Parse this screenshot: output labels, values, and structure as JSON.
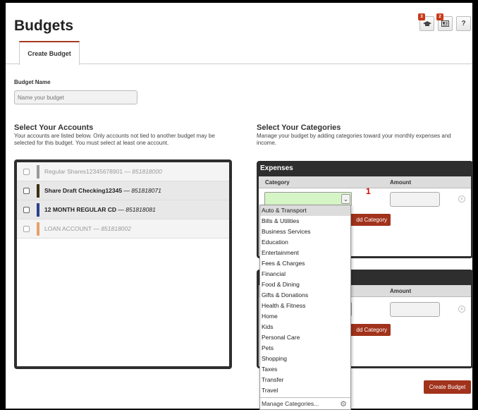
{
  "header": {
    "title": "Budgets",
    "badges": {
      "learn": "3",
      "news": "2"
    },
    "help_label": "?"
  },
  "tabs": [
    {
      "label": "Create Budget",
      "active": true
    }
  ],
  "budget_name": {
    "label": "Budget Name",
    "placeholder": "Name your budget",
    "value": ""
  },
  "accounts": {
    "title": "Select Your Accounts",
    "description": "Your accounts are listed below. Only accounts not tied to another budget may be selected for this budget. You must select at least one account.",
    "items": [
      {
        "name": "Regular Shares12345678901",
        "number": "851818000",
        "color": "#9a9a9a",
        "state": "disabled"
      },
      {
        "name": "Share Draft Checking12345",
        "number": "851818071",
        "color": "#3b2f13",
        "state": "enabled"
      },
      {
        "name": "12 MONTH REGULAR CD",
        "number": "851818081",
        "color": "#2d3f8f",
        "state": "enabled"
      },
      {
        "name": "LOAN ACCOUNT",
        "number": "851818002",
        "color": "#e8a06a",
        "state": "disabled"
      }
    ]
  },
  "categories": {
    "title": "Select Your Categories",
    "description": "Manage your budget by adding categories toward your monthly expenses and income.",
    "expenses": {
      "title": "Expenses",
      "col_category": "Category",
      "col_amount": "Amount",
      "add_label": "dd Category"
    },
    "income": {
      "title": "I",
      "col_amount": "Amount",
      "add_label": "dd Category"
    },
    "annotation": "1",
    "dropdown_options": [
      "Auto & Transport",
      "Bills & Utilities",
      "Business Services",
      "Education",
      "Entertainment",
      "Fees & Charges",
      "Financial",
      "Food & Dining",
      "Gifts & Donations",
      "Health & Fitness",
      "Home",
      "Kids",
      "Personal Care",
      "Pets",
      "Shopping",
      "Taxes",
      "Transfer",
      "Travel"
    ],
    "highlighted_option": "Auto & Transport",
    "manage_label": "Manage Categories..."
  },
  "create_button": "Create Budget",
  "colors": {
    "accent": "#a1321b",
    "selected_field": "#d6f5c6",
    "panel": "#2e2e2e"
  }
}
